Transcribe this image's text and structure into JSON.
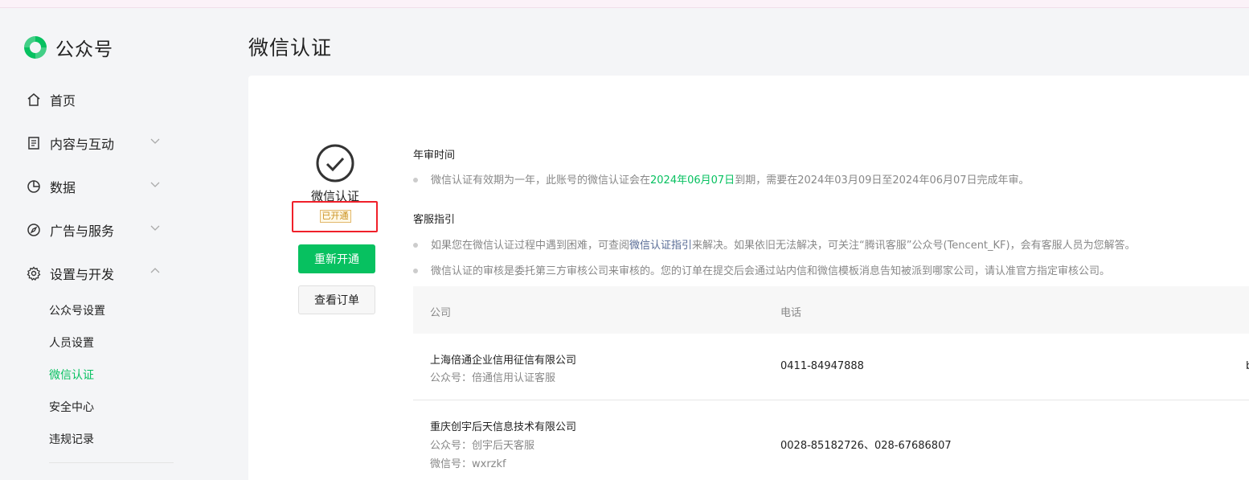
{
  "app": {
    "name": "公众号"
  },
  "nav": {
    "home": "首页",
    "content": "内容与互动",
    "data": "数据",
    "ads": "广告与服务",
    "settings": "设置与开发",
    "sub": {
      "account": "公众号设置",
      "members": "人员设置",
      "verification": "微信认证",
      "security": "安全中心",
      "violations": "违规记录"
    }
  },
  "page": {
    "title": "微信认证"
  },
  "status": {
    "label": "微信认证",
    "badge": "已开通",
    "renew_button": "重新开通",
    "orders_button": "查看订单"
  },
  "annual": {
    "title": "年审时间",
    "text_pre": "微信认证有效期为一年，此账号的微信认证会在",
    "expiry": "2024年06月07日",
    "text_post": "到期，需要在2024年03月09日至2024年06月07日完成年审。"
  },
  "guide": {
    "title": "客服指引",
    "line1_pre": "如果您在微信认证过程中遇到困难，可查阅",
    "line1_link": "微信认证指引",
    "line1_post": "来解决。如果依旧无法解决，可关注“腾讯客服”公众号(Tencent_KF)，会有客服人员为您解答。",
    "line2": "微信认证的审核是委托第三方审核公司来审核的。您的订单在提交后会通过站内信和微信模板消息告知被派到哪家公司，请认准官方指定审核公司。"
  },
  "table": {
    "headers": {
      "company": "公司",
      "phone": "电话"
    },
    "rows": [
      {
        "company": "上海倍通企业信用征信有限公司",
        "account": "公众号：倍通信用认证客服",
        "phone": "0411-84947888",
        "clipped": "b"
      },
      {
        "company": "重庆创宇后天信息技术有限公司",
        "account": "公众号：创宇后天客服",
        "wechat": "微信号：wxrzkf",
        "phone": "0028-85182726、028-67686807"
      }
    ]
  },
  "colors": {
    "brand": "#07c160",
    "link": "#576b95",
    "highlight_box": "#f0202a"
  }
}
